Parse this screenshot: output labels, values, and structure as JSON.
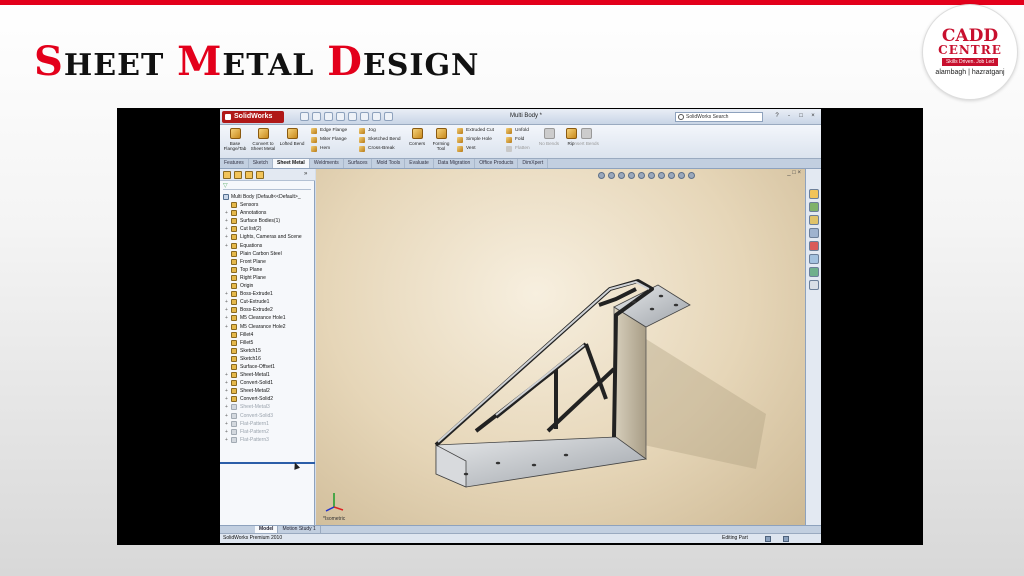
{
  "slide": {
    "title_parts": [
      {
        "cap": "S",
        "rest": "HEET"
      },
      {
        "cap": "M",
        "rest": "ETAL"
      },
      {
        "cap": "D",
        "rest": "ESIGN"
      }
    ]
  },
  "logo": {
    "line1": "CADD",
    "line2": "CENTRE",
    "tagline": "Skills Driven. Job Led",
    "location": "alambagh | hazratganj"
  },
  "app": {
    "name": "SolidWorks",
    "document_title": "Multi Body *",
    "search_placeholder": "SolidWorks Search",
    "window_buttons": [
      "?",
      "-",
      "□",
      "×"
    ],
    "viewport_buttons": "_ □ ×"
  },
  "ribbon": {
    "big_buttons": [
      {
        "label": "Base Flange/Tab",
        "icon": "base-flange-icon"
      },
      {
        "label": "Convert to Sheet Metal",
        "icon": "convert-sheet-metal-icon"
      },
      {
        "label": "Lofted Bend",
        "icon": "lofted-bend-icon"
      },
      {
        "label": "Corners",
        "icon": "corners-icon"
      },
      {
        "label": "Forming Tool",
        "icon": "forming-tool-icon"
      },
      {
        "label": "No Bends",
        "icon": "no-bends-icon"
      },
      {
        "label": "Rip",
        "icon": "rip-icon"
      },
      {
        "label": "Insert Bends",
        "icon": "insert-bends-icon"
      }
    ],
    "small_buttons": [
      {
        "label": "Edge Flange"
      },
      {
        "label": "Miter Flange"
      },
      {
        "label": "Hem"
      },
      {
        "label": "Jog"
      },
      {
        "label": "Sketched Bend"
      },
      {
        "label": "Cross-Break"
      },
      {
        "label": "Extruded Cut"
      },
      {
        "label": "Simple Hole"
      },
      {
        "label": "Vent"
      },
      {
        "label": "Unfold"
      },
      {
        "label": "Fold"
      },
      {
        "label": "Flatten"
      }
    ]
  },
  "tabs": [
    "Features",
    "Sketch",
    "Sheet Metal",
    "Weldments",
    "Surfaces",
    "Mold Tools",
    "Evaluate",
    "Data Migration",
    "Office Products",
    "DimXpert"
  ],
  "active_tab": "Sheet Metal",
  "tree": {
    "root": "Multi Body  (Default<<Default>_",
    "items": [
      "Sensors",
      "Annotations",
      "Surface Bodies(1)",
      "Cut list(2)",
      "Lights, Cameras and Scene",
      "Equations",
      "Plain Carbon Steel",
      "Front Plane",
      "Top Plane",
      "Right Plane",
      "Origin",
      "Boss-Extrude1",
      "Cut-Extrude1",
      "Boss-Extrude2",
      "M5 Clearance Hole1",
      "M5 Clearance Hole2",
      "Fillet4",
      "Fillet5",
      "Sketch15",
      "Sketch16",
      "Surface-Offset1",
      "Sheet-Metal1",
      "Convert-Solid1",
      "Sheet-Metal2",
      "Convert-Solid2"
    ],
    "suppressed": [
      "Sheet-Metal3",
      "Convert-Solid3",
      "Flat-Pattern1",
      "Flat-Pattern2",
      "Flat-Pattern3"
    ]
  },
  "viewport": {
    "orientation": "*Isometric"
  },
  "bottom_tabs": [
    "Model",
    "Motion Study 1"
  ],
  "active_bottom_tab": "Model",
  "status": {
    "left": "SolidWorks Premium 2010",
    "right": "Editing Part"
  },
  "colors": {
    "accent_red": "#e3001b",
    "brand_red": "#c8102e",
    "part_metal": "#b8bcc2",
    "viewport_bg": "#e6d6b8"
  }
}
